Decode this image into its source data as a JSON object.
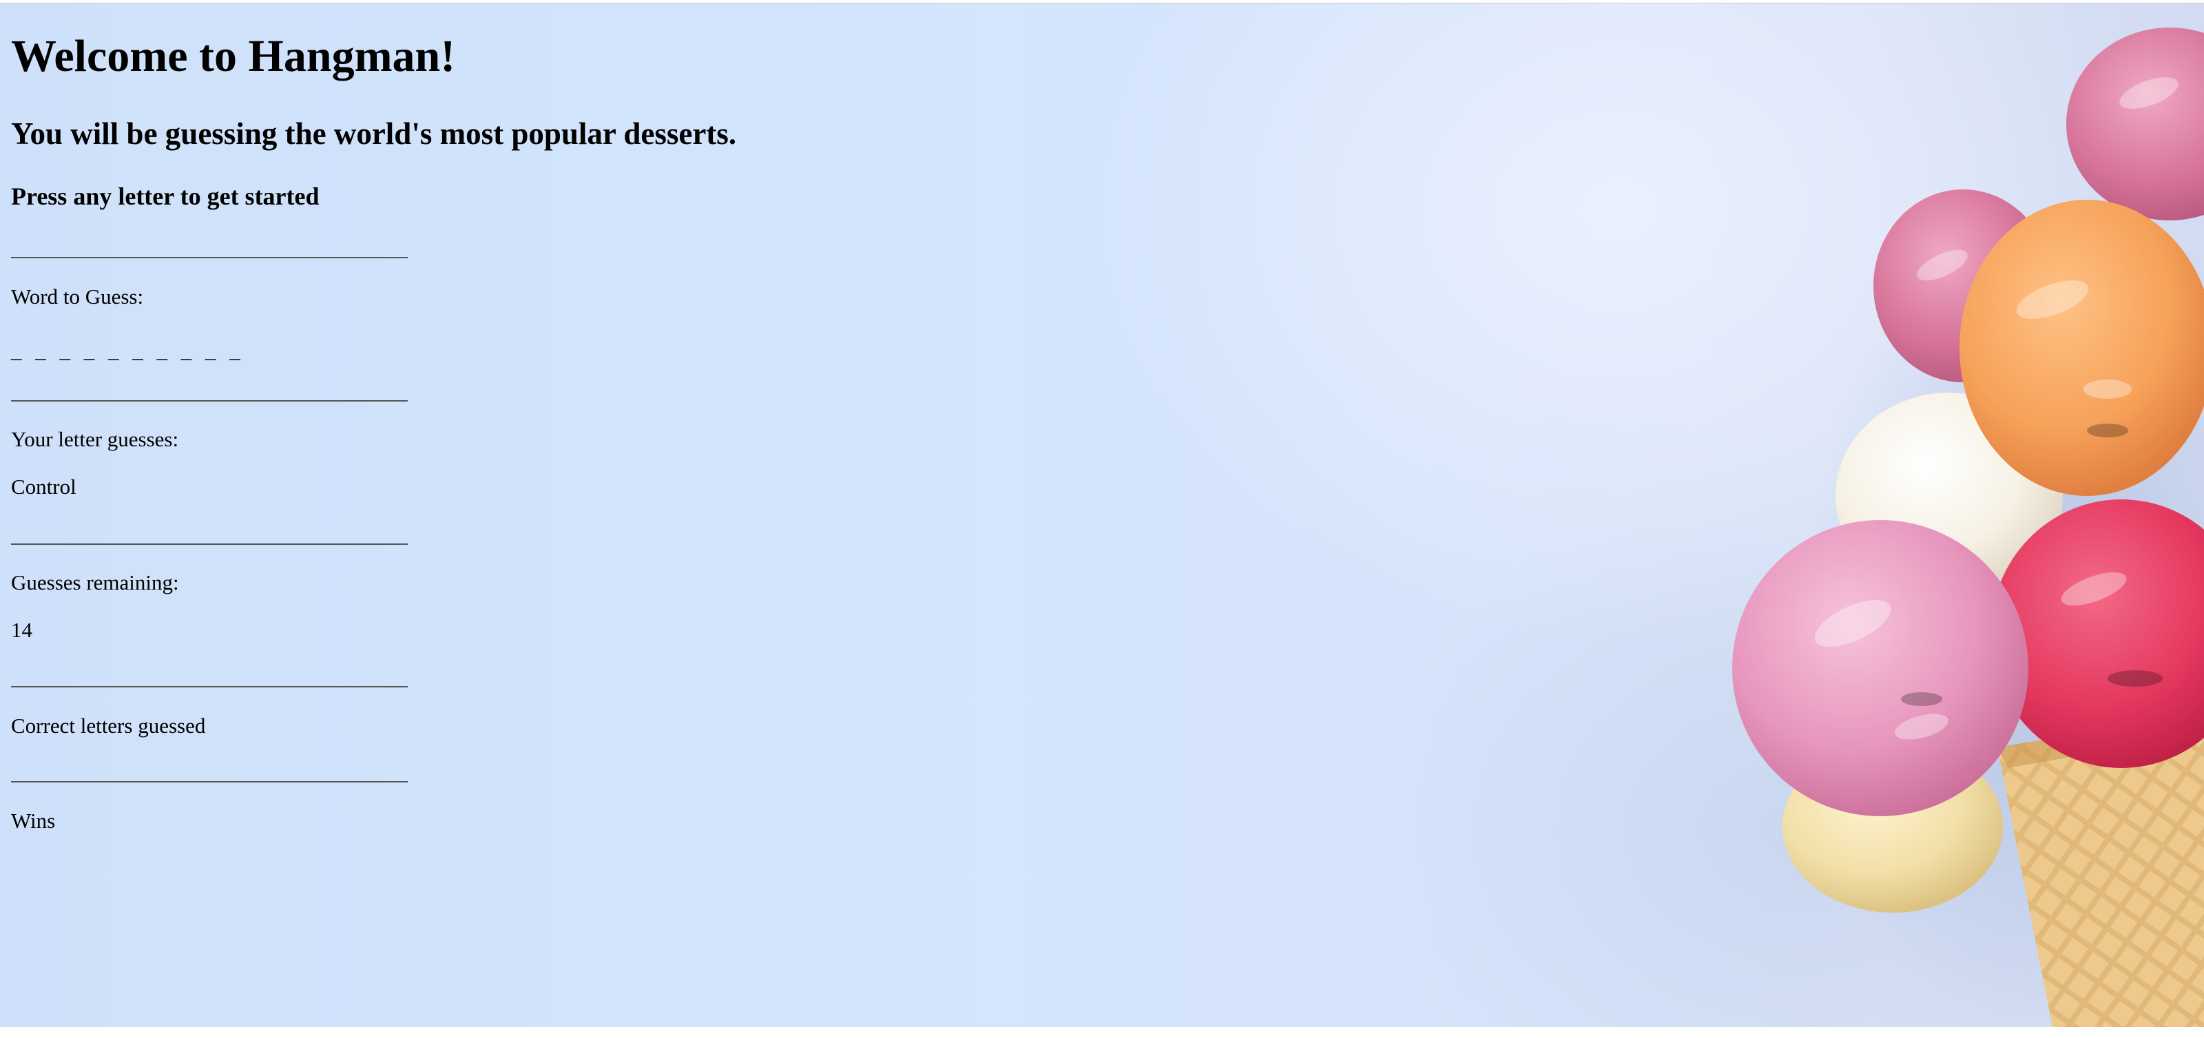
{
  "game": {
    "title": "Welcome to Hangman!",
    "subtitle": "You will be guessing the world's most popular desserts.",
    "instruction": "Press any letter to get started",
    "word_label": "Word to Guess:",
    "word_display": "_ _ _ _ _ _ _ _ _ _",
    "guesses_label": "Your letter guesses:",
    "guesses_value": "Control",
    "remaining_label": "Guesses remaining:",
    "remaining_value": "14",
    "correct_label": "Correct letters guessed",
    "wins_label": "Wins"
  },
  "background": {
    "image": "ice-cream-cone",
    "colors": {
      "sky": "#d3e5fc",
      "pink": "#e48fb6",
      "orange": "#f6a25a",
      "red": "#e5385f",
      "cream": "#f6f1e4",
      "vanilla": "#f2dfa8",
      "cone": "#dcae6a"
    }
  }
}
